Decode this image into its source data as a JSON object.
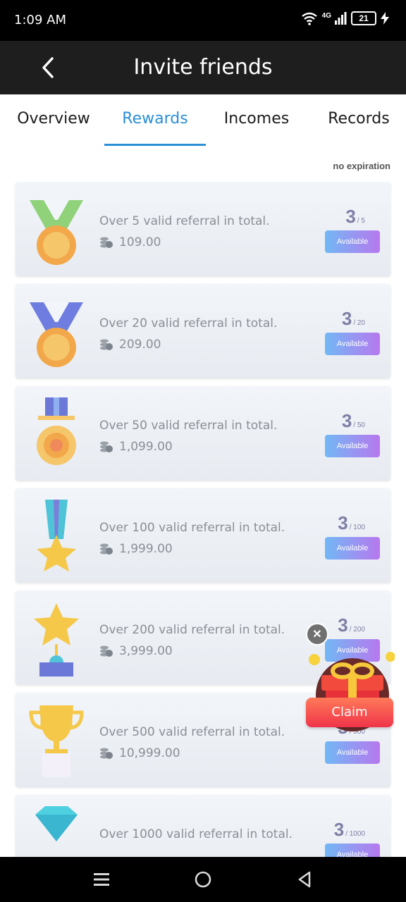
{
  "status_bar": {
    "time": "1:09 AM",
    "network": "4G",
    "battery": "21"
  },
  "header": {
    "title": "Invite friends"
  },
  "tabs": [
    {
      "label": "Overview",
      "active": false
    },
    {
      "label": "Rewards",
      "active": true
    },
    {
      "label": "Incomes",
      "active": false
    },
    {
      "label": "Records",
      "active": false
    }
  ],
  "expiry_note": "no expiration",
  "rewards": [
    {
      "title": "Over 5 valid referral in total.",
      "amount": "109.00",
      "current": "3",
      "total": "/ 5",
      "button": "Available",
      "medal_icon": "medal-green-icon"
    },
    {
      "title": "Over 20 valid referral in total.",
      "amount": "209.00",
      "current": "3",
      "total": "/ 20",
      "button": "Available",
      "medal_icon": "medal-blue-icon"
    },
    {
      "title": "Over 50 valid referral in total.",
      "amount": "1,099.00",
      "current": "3",
      "total": "/ 50",
      "button": "Available",
      "medal_icon": "medal-ribbon-icon"
    },
    {
      "title": "Over 100 valid referral in total.",
      "amount": "1,999.00",
      "current": "3",
      "total": "/ 100",
      "button": "Available",
      "medal_icon": "star-medal-icon"
    },
    {
      "title": "Over 200 valid referral in total.",
      "amount": "3,999.00",
      "current": "3",
      "total": "/ 200",
      "button": "Available",
      "medal_icon": "star-trophy-icon"
    },
    {
      "title": "Over 500 valid referral in total.",
      "amount": "10,999.00",
      "current": "3",
      "total": "/ 500",
      "button": "Available",
      "medal_icon": "trophy-cup-icon"
    },
    {
      "title": "Over 1000 valid referral in total.",
      "amount": "",
      "current": "3",
      "total": "/ 1000",
      "button": "Available",
      "medal_icon": "diamond-icon"
    }
  ],
  "floating": {
    "claim_label": "Claim",
    "close_icon": "close-icon",
    "gift_icon": "gift-box-icon"
  },
  "colors": {
    "accent": "#2b8fd6",
    "button_gradient_start": "#72b8f5",
    "button_gradient_end": "#b778ee",
    "claim_red": "#f0344a"
  }
}
